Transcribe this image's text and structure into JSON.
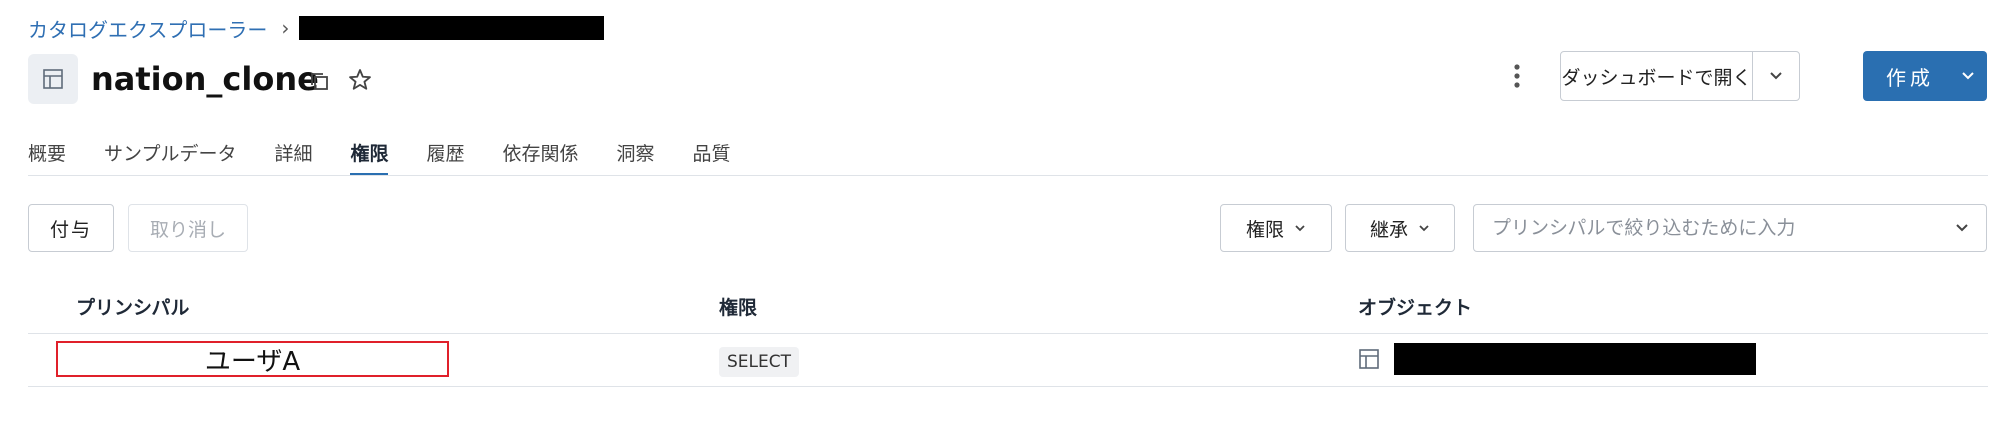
{
  "breadcrumb": {
    "root_label": "カタログエクスプローラー",
    "separator": "›"
  },
  "header": {
    "title": "nation_clone",
    "dashboard_button": "ダッシュボードで開く",
    "create_button": "作成"
  },
  "tabs": [
    {
      "label": "概要",
      "active": false
    },
    {
      "label": "サンプルデータ",
      "active": false
    },
    {
      "label": "詳細",
      "active": false
    },
    {
      "label": "権限",
      "active": true
    },
    {
      "label": "履歴",
      "active": false
    },
    {
      "label": "依存関係",
      "active": false
    },
    {
      "label": "洞察",
      "active": false
    },
    {
      "label": "品質",
      "active": false
    }
  ],
  "toolbar": {
    "grant_button": "付与",
    "revoke_button": "取り消し",
    "privilege_filter": "権限",
    "inheritance_filter": "継承",
    "principal_search_placeholder": "プリンシパルで絞り込むために入力"
  },
  "table": {
    "columns": [
      "プリンシパル",
      "権限",
      "オブジェクト"
    ],
    "rows": [
      {
        "principal": "ユーザA",
        "privilege": "SELECT",
        "object_icon": "table-icon"
      }
    ]
  },
  "colors": {
    "accent": "#2a6fb1",
    "link": "#2f6fb3",
    "highlight_border": "#e0202a",
    "redaction": "#000000"
  }
}
